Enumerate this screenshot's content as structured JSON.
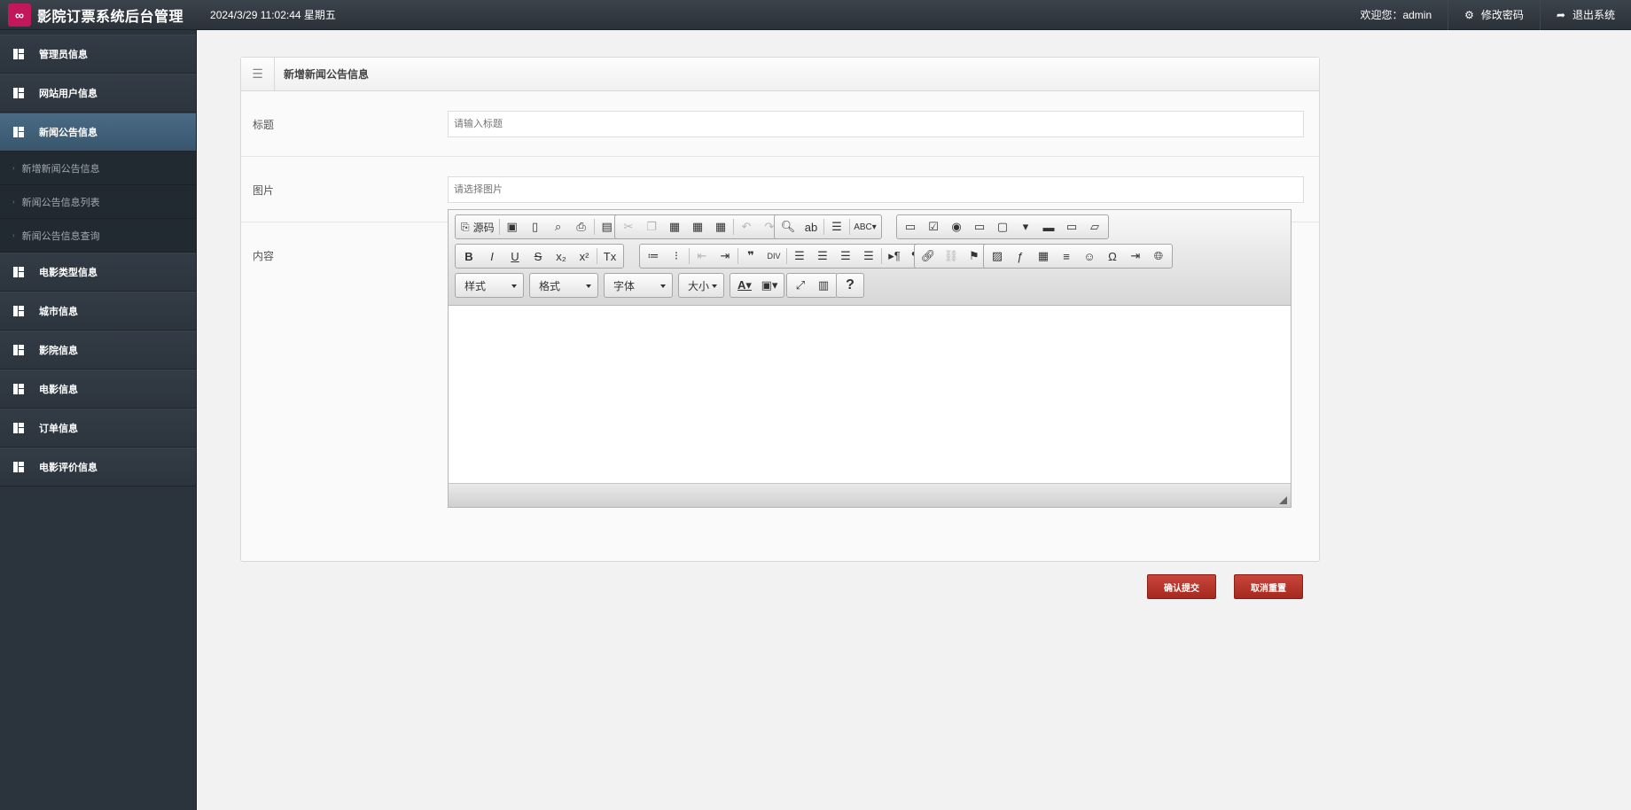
{
  "header": {
    "app_title": "影院订票系统后台管理",
    "datetime": "2024/3/29 11:02:44 星期五",
    "welcome": "欢迎您：admin",
    "change_password": "修改密码",
    "logout": "退出系统"
  },
  "sidebar": {
    "items": [
      {
        "label": "管理员信息"
      },
      {
        "label": "网站用户信息"
      },
      {
        "label": "新闻公告信息",
        "active": true
      },
      {
        "label": "电影类型信息"
      },
      {
        "label": "城市信息"
      },
      {
        "label": "影院信息"
      },
      {
        "label": "电影信息"
      },
      {
        "label": "订单信息"
      },
      {
        "label": "电影评价信息"
      }
    ],
    "sub_items": [
      {
        "label": "新增新闻公告信息"
      },
      {
        "label": "新闻公告信息列表"
      },
      {
        "label": "新闻公告信息查询"
      }
    ]
  },
  "panel": {
    "title": "新增新闻公告信息",
    "fields": {
      "title_label": "标题",
      "title_placeholder": "请输入标题",
      "image_label": "图片",
      "image_placeholder": "请选择图片",
      "content_label": "内容"
    }
  },
  "editor": {
    "source_label": "源码",
    "combos": {
      "style": "样式",
      "format": "格式",
      "font": "字体",
      "size": "大小"
    }
  },
  "buttons": {
    "submit": "确认提交",
    "reset": "取消重置"
  }
}
